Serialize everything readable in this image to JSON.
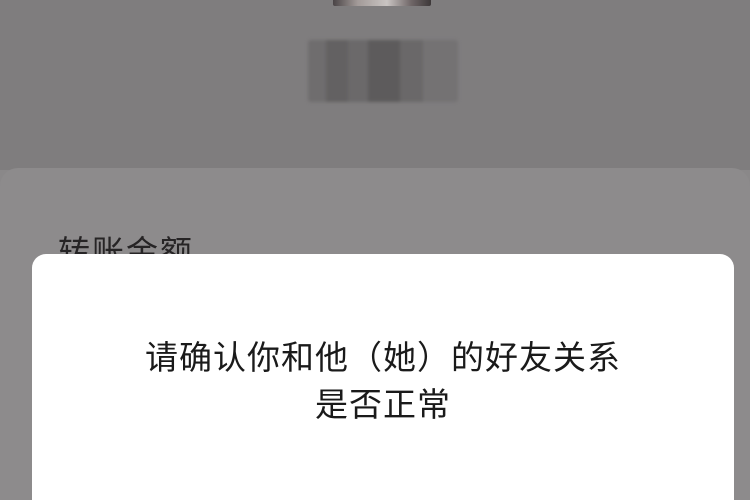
{
  "sheet": {
    "label": "转账金额"
  },
  "dialog": {
    "message_line1": "请确认你和他（她）的好友关系",
    "message_line2": "是否正常"
  }
}
